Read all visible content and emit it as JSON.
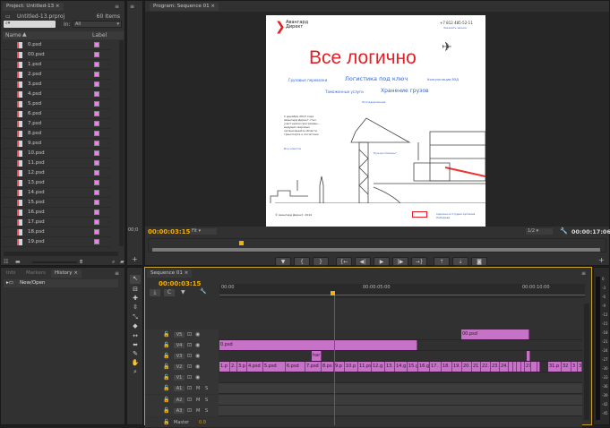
{
  "project": {
    "tab": "Project: Untitled-13",
    "file": "Untitled-13.prproj",
    "count": "60 Items",
    "in_label": "In:",
    "in_value": "All",
    "col_name": "Name",
    "col_label": "Label",
    "items": [
      "0.psd",
      "00.psd",
      "1.psd",
      "2.psd",
      "3.psd",
      "4.psd",
      "5.psd",
      "6.psd",
      "7.psd",
      "8.psd",
      "9.psd",
      "10.psd",
      "11.psd",
      "12.psd",
      "13.psd",
      "14.psd",
      "15.psd",
      "16.psd",
      "17.psd",
      "18.psd",
      "19.psd"
    ],
    "label_color": "#f07ef0"
  },
  "source": {
    "tc": "00;0"
  },
  "program": {
    "tab": "Program: Sequence 01",
    "timecode": "00:00:03:15",
    "fit": "Fit",
    "quality": "1/2",
    "duration": "00:00:17:06",
    "controls": [
      "mark",
      "in",
      "out",
      "go-in",
      "step-back",
      "play",
      "step-fwd",
      "go-out",
      "lift",
      "extract",
      "export-frame"
    ]
  },
  "frame": {
    "logo_line1": "Авангард",
    "logo_line2": "Директ",
    "phone": "+7 812 485-52-11",
    "callback": "Заказать звонок",
    "headline": "Все логично",
    "links": [
      "Грузовые перевозки",
      "Логистика под ключ",
      "Консультации ВЭД",
      "Таможенные услуги",
      "Хранение грузов",
      "Экспедирование"
    ],
    "news": "С декабря 2013 года Авангард Директ стал участником программы ... ведущих мировых организаций в области транспорта и логистики",
    "more": "Все новости",
    "ask": "Нужна помощь?",
    "copyright": "© Авангард Директ, 2014",
    "footer": "Сделано в Студии Артемия Лебедева"
  },
  "bottom_left": {
    "tabs": [
      "Info",
      "Markers",
      "History"
    ],
    "history": [
      "New/Open"
    ]
  },
  "timeline": {
    "tab": "Sequence 01",
    "timecode": "00:00:03:15",
    "ruler": [
      "00:00",
      "00:00:05:00",
      "00:00:10:00"
    ],
    "video_tracks": [
      "V5",
      "V4",
      "V3",
      "V2",
      "V1"
    ],
    "audio_tracks": [
      "A1",
      "A2",
      "A3"
    ],
    "master": "Master",
    "master_val": "0.0",
    "m": "M",
    "s": "S",
    "v5": [
      "00.psd"
    ],
    "v4": [
      "0.psd"
    ],
    "v3": [
      "har",
      ""
    ],
    "v2": [
      "1.p",
      "2.",
      "3.p",
      "4.psd",
      "5.psd",
      "6.psd",
      "7.psd",
      "8.ps",
      "9.p",
      "10.p",
      "11.ps",
      "12.g",
      "13.",
      "14.g",
      "15.g",
      "16.g",
      "17.",
      "18.",
      "19.",
      "20.",
      "21",
      "22.",
      "23.",
      "24.",
      "",
      "",
      "",
      "",
      "27",
      "",
      "",
      "31.p",
      "32",
      "3",
      "3"
    ]
  },
  "meters": [
    "0",
    "-3",
    "-6",
    "-9",
    "-12",
    "-15",
    "-18",
    "-21",
    "-24",
    "-27",
    "-30",
    "-33",
    "-36",
    "-39",
    "-42",
    "-45"
  ]
}
